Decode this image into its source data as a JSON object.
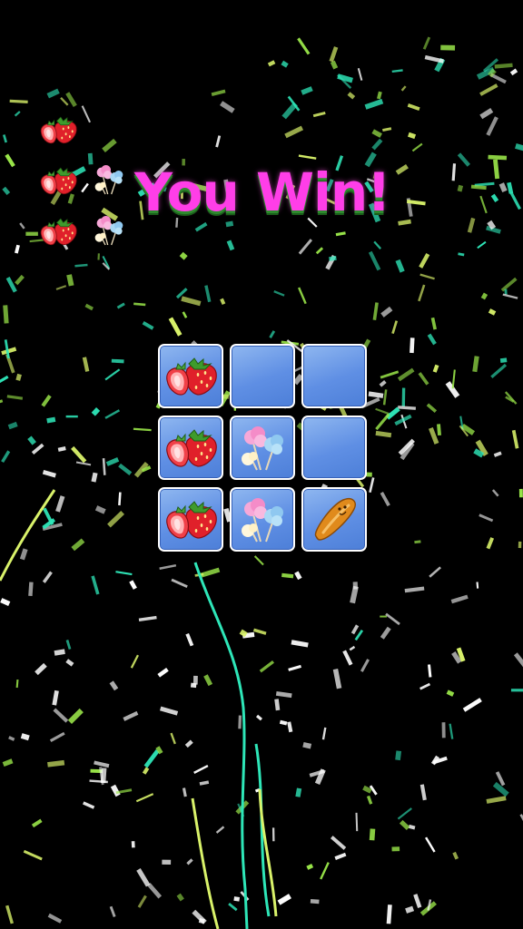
{
  "title": "You Win!",
  "colors": {
    "title": "#ff3ee8",
    "title_shadow": "#2e8a2e",
    "tile_bg": "#6a9ae6",
    "tile_border": "#ffffff",
    "background": "#000000",
    "confetti": [
      "#2ee6b8",
      "#d9f26a",
      "#ffffff",
      "#9be84a"
    ]
  },
  "collected": [
    {
      "items": [
        "strawberry-icon"
      ]
    },
    {
      "items": [
        "strawberry-icon",
        "cotton-candy-icon"
      ]
    },
    {
      "items": [
        "strawberry-icon",
        "cotton-candy-icon"
      ]
    }
  ],
  "board": [
    [
      "strawberry-icon",
      "empty",
      "empty"
    ],
    [
      "strawberry-icon",
      "cotton-candy-icon",
      "empty"
    ],
    [
      "strawberry-icon",
      "cotton-candy-icon",
      "bread-icon"
    ]
  ]
}
